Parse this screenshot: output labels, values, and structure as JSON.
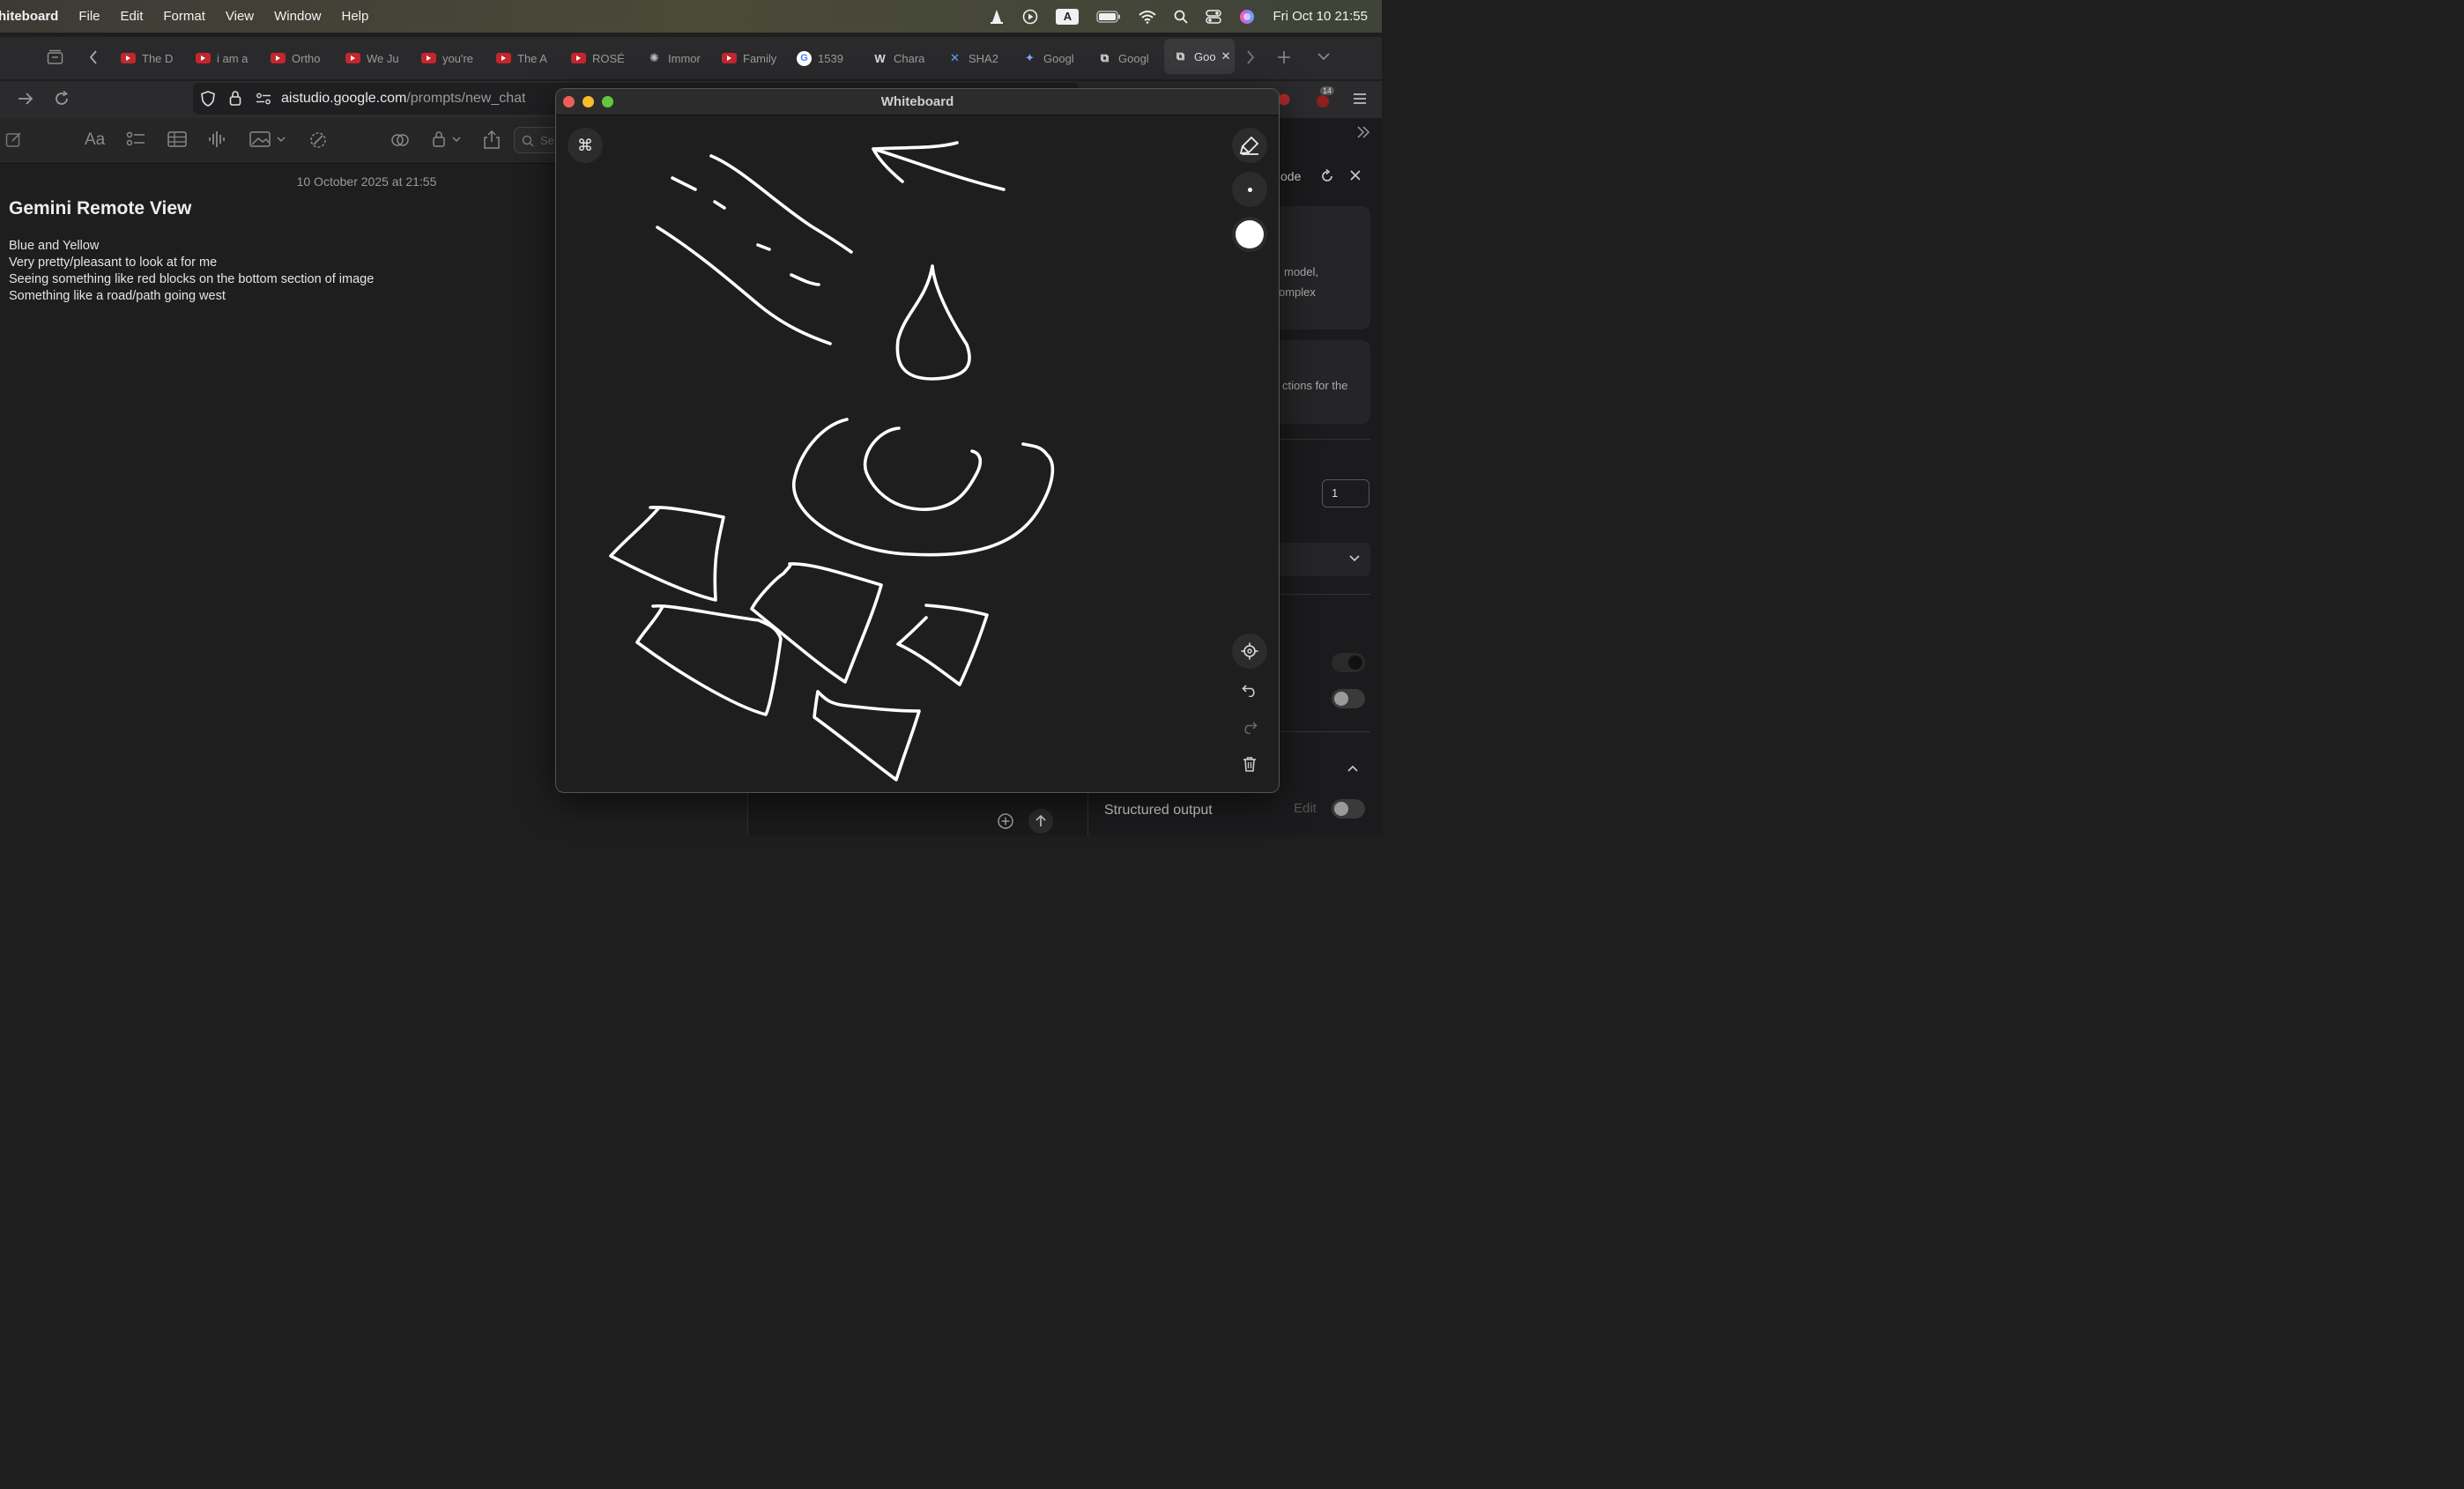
{
  "menubar": {
    "app_name": "hiteboard",
    "items": [
      "File",
      "Edit",
      "Format",
      "View",
      "Window",
      "Help"
    ],
    "keyboard_indicator": "A",
    "clock": "Fri Oct 10  21:55"
  },
  "browser": {
    "tabs": [
      {
        "title": "The D",
        "icon": "youtube-icon"
      },
      {
        "title": "i am a",
        "icon": "youtube-icon"
      },
      {
        "title": "Ortho",
        "icon": "youtube-icon"
      },
      {
        "title": "We Ju",
        "icon": "youtube-icon"
      },
      {
        "title": "you're",
        "icon": "youtube-icon"
      },
      {
        "title": "The A",
        "icon": "youtube-icon"
      },
      {
        "title": "ROSÉ",
        "icon": "youtube-icon"
      },
      {
        "title": "Immor",
        "icon": "openai-icon"
      },
      {
        "title": "Family",
        "icon": "youtube-icon"
      },
      {
        "title": "1539",
        "icon": "google-icon"
      },
      {
        "title": "Chara",
        "icon": "wikipedia-icon"
      },
      {
        "title": "SHA2",
        "icon": "tools-icon"
      },
      {
        "title": "Googl",
        "icon": "gemini-icon"
      },
      {
        "title": "Googl",
        "icon": "external-icon"
      },
      {
        "title": "Goo",
        "icon": "external-icon",
        "active": true
      }
    ],
    "url_dim_prefix": "aistudio.",
    "url_domain": "google.com",
    "url_path": "/prompts/new_chat",
    "extension_badge": "14"
  },
  "notes": {
    "toolbar_font_label": "Aa",
    "search_placeholder": "Se",
    "date": "10 October 2025 at 21:55",
    "title": "Gemini Remote View",
    "lines": [
      "Blue and Yellow",
      "Very pretty/pleasant to look at for me",
      "Seeing something like red blocks on the bottom section of image",
      "Something like a road/path going west"
    ]
  },
  "whiteboard": {
    "window_title": "Whiteboard",
    "command_key_symbol": "⌘",
    "brush_colors": {
      "active": "#ffffff"
    }
  },
  "studio": {
    "header_fragment": "ode",
    "card1_lines": [
      "model,",
      "omplex"
    ],
    "card2_line": "ctions for the",
    "number_input_value": "1",
    "structured_output_label": "Structured output",
    "edit_label": "Edit"
  }
}
